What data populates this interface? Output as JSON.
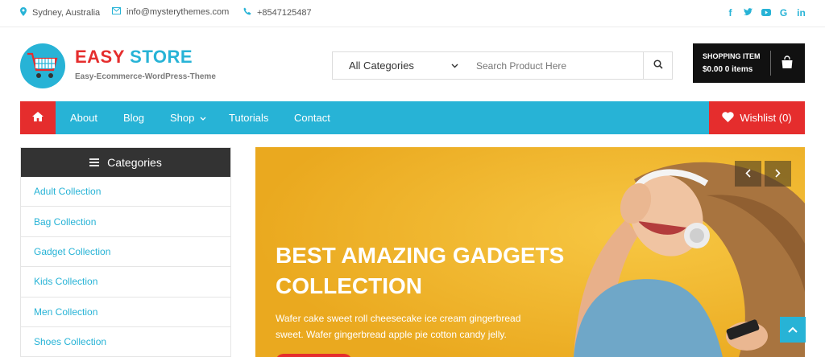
{
  "topbar": {
    "location": "Sydney, Australia",
    "email": "info@mysterythemes.com",
    "phone": "+8547125487",
    "social": [
      "facebook-icon",
      "twitter-icon",
      "youtube-icon",
      "google-icon",
      "linkedin-icon"
    ]
  },
  "header": {
    "logo_word1": "EASY",
    "logo_word2": "STORE",
    "tagline": "Easy-Ecommerce-WordPress-Theme",
    "search": {
      "category": "All Categories",
      "placeholder": "Search Product Here"
    },
    "cart": {
      "label": "SHOPPING ITEM",
      "summary": "$0.00 0 items"
    }
  },
  "nav": {
    "items": [
      {
        "label": "About"
      },
      {
        "label": "Blog"
      },
      {
        "label": "Shop"
      },
      {
        "label": "Tutorials"
      },
      {
        "label": "Contact"
      }
    ],
    "wishlist": "Wishlist (0)"
  },
  "sidebar": {
    "title": "Categories",
    "items": [
      "Adult Collection",
      "Bag Collection",
      "Gadget Collection",
      "Kids Collection",
      "Men Collection",
      "Shoes Collection"
    ]
  },
  "slider": {
    "title": "BEST AMAZING GADGETS COLLECTION",
    "description": "Wafer cake sweet roll cheesecake ice cream gingerbread sweet. Wafer gingerbread apple pie cotton candy jelly."
  },
  "colors": {
    "accent": "#27b3d6",
    "brand_red": "#e52d2d",
    "slider_bg": "#f2b52a",
    "dark": "#333333"
  }
}
